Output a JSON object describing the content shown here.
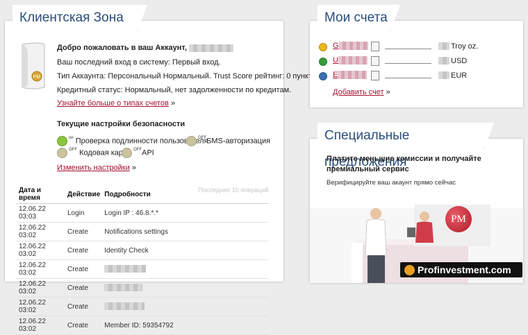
{
  "client_zone": {
    "title": "Клиентская Зона",
    "welcome": "Добро пожаловать в ваш Аккаунт,",
    "last_login": "Ваш последний вход в систему: Первый вход.",
    "account_type": "Тип Аккаунта: Персональный Нормальный. Trust Score рейтинг: 0 пунктов.",
    "credit_status": "Кредитный статус: Нормальный, нет задолженности по кредитам.",
    "learn_more": "Узнайте больше о типах счетов",
    "learn_more_arrow": "»",
    "security_heading": "Текущие настройки безопасности",
    "security": [
      {
        "state": "on",
        "label": "Проверка подлинности пользователя"
      },
      {
        "state": "off",
        "label": "SMS-авторизация"
      },
      {
        "state": "off",
        "label": "Кодовая карта"
      },
      {
        "state": "off",
        "label": "API"
      }
    ],
    "change_settings": "Изменить настройки",
    "change_arrow": "»",
    "history": {
      "headers": [
        "Дата и время",
        "Действие",
        "Подробности"
      ],
      "caption": "Последние 10 операций",
      "rows": [
        {
          "date": "12.06.22 03:03",
          "action": "Login",
          "details": "Login IP : 46.8.*.*"
        },
        {
          "date": "12.06.22 03:02",
          "action": "Create",
          "details": "Notifications settings"
        },
        {
          "date": "12.06.22 03:02",
          "action": "Create",
          "details": "Identity Check"
        },
        {
          "date": "12.06.22 03:02",
          "action": "Create",
          "details": ""
        },
        {
          "date": "12.06.22 03:02",
          "action": "Create",
          "details": ""
        },
        {
          "date": "12.06.22 03:02",
          "action": "Create",
          "details": ""
        },
        {
          "date": "12.06.22 03:02",
          "action": "Create",
          "details": "Member ID: 59354792"
        }
      ]
    }
  },
  "accounts": {
    "title": "Мои счета",
    "items": [
      {
        "prefix": "G",
        "currency": "Troy oz.",
        "coin_color": "#e8b820"
      },
      {
        "prefix": "U",
        "currency": "USD",
        "coin_color": "#3a9a3a"
      },
      {
        "prefix": "E",
        "currency": "EUR",
        "coin_color": "#3b6fb0"
      }
    ],
    "add_account": "Добавить счет",
    "add_arrow": "»"
  },
  "offers": {
    "title": "Специальные предложения",
    "headline": "Платите меньшие комиссии и получайте премиальный сервис",
    "subtext": "Верифицируйте ваш акаунт прямо сейчас",
    "logo_text": "PM"
  },
  "watermark": {
    "text": "Profinvestment.com"
  }
}
